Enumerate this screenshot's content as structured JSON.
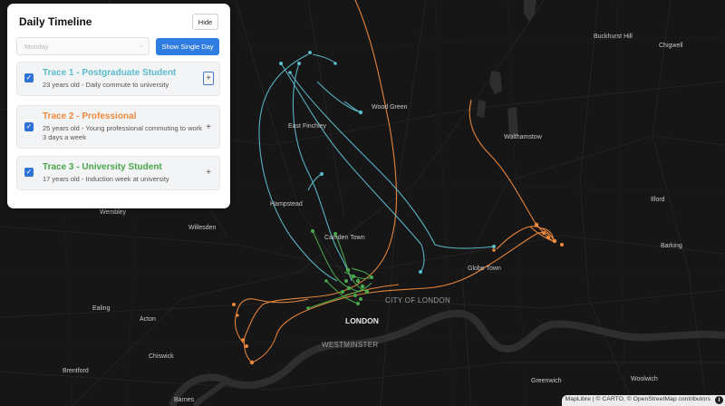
{
  "panel": {
    "title": "Daily Timeline",
    "hide_label": "Hide",
    "day_select": {
      "value": "Monday"
    },
    "show_single_day_label": "Show Single Day",
    "traces": [
      {
        "name": "Trace 1 - Postgraduate Student",
        "description": "23 years old - Daily commute to university",
        "color": "#5bbccc",
        "checked": true
      },
      {
        "name": "Trace 2 - Professional",
        "description": "25 years old - Young professional commuting to work 3 days a week",
        "color": "#f08a3c",
        "checked": true
      },
      {
        "name": "Trace 3 - University Student",
        "description": "17 years old - Induction week at university",
        "color": "#4aa84a",
        "checked": true
      }
    ],
    "expand_symbol": "+"
  },
  "map": {
    "background": "#161616",
    "water_color": "#2e2e2e",
    "labels": {
      "buckhurst_hill": "Buckhurst Hill",
      "chigwell": "Chigwell",
      "wood_green": "Wood Green",
      "east_finchley": "East Finchley",
      "walthamstow": "Walthamstow",
      "hampstead": "Hampstead",
      "ilford": "Ilford",
      "wembley": "Wembley",
      "willesden": "Willesden",
      "camden_town": "Camden Town",
      "barking": "Barking",
      "globe_town": "Globe Town",
      "city_of_london": "CITY OF LONDON",
      "london": "LONDON",
      "ealing": "Ealing",
      "acton": "Acton",
      "westminster": "WESTMINSTER",
      "chiswick": "Chiswick",
      "brentford": "Brentford",
      "greenwich": "Greenwich",
      "woolwich": "Woolwich",
      "barnes": "Barnes"
    },
    "attribution": "MapLibre | © CARTO, © OpenStreetMap contributors",
    "info_symbol": "i"
  }
}
